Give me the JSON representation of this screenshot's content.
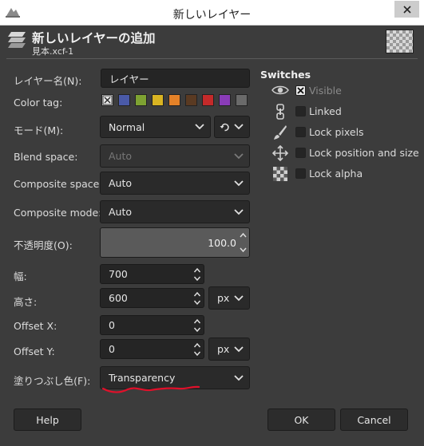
{
  "window": {
    "title": "新しいレイヤー"
  },
  "header": {
    "title": "新しいレイヤーの追加",
    "subtitle": "見本.xcf-1"
  },
  "form": {
    "layer_name": {
      "label": "レイヤー名(N):",
      "value": "レイヤー"
    },
    "color_tag": {
      "label": "Color tag:",
      "swatches": [
        "#4a5aa8",
        "#7ea232",
        "#d9b422",
        "#e58228",
        "#5a3a22",
        "#c42a2a",
        "#8a3cb8",
        "#6a6a6a"
      ]
    },
    "mode": {
      "label": "モード(M):",
      "value": "Normal"
    },
    "blend_space": {
      "label": "Blend space:",
      "value": "Auto"
    },
    "composite_space": {
      "label": "Composite space:",
      "value": "Auto"
    },
    "composite_mode": {
      "label": "Composite mode:",
      "value": "Auto"
    },
    "opacity": {
      "label": "不透明度(O):",
      "value": "100.0"
    },
    "width": {
      "label": "幅:",
      "value": "700"
    },
    "height": {
      "label": "高さ:",
      "value": "600",
      "unit": "px"
    },
    "offset_x": {
      "label": "Offset X:",
      "value": "0"
    },
    "offset_y": {
      "label": "Offset Y:",
      "value": "0",
      "unit": "px"
    },
    "fill": {
      "label": "塗りつぶし色(F):",
      "value": "Transparency"
    }
  },
  "switches": {
    "title": "Switches",
    "items": [
      {
        "label": "Visible",
        "icon": "eye-icon",
        "checked": true
      },
      {
        "label": "Linked",
        "icon": "chain-icon",
        "checked": false
      },
      {
        "label": "Lock pixels",
        "icon": "brush-icon",
        "checked": false
      },
      {
        "label": "Lock position and size",
        "icon": "move-icon",
        "checked": false
      },
      {
        "label": "Lock alpha",
        "icon": "checkerboard-icon",
        "checked": false
      }
    ]
  },
  "buttons": {
    "help": "Help",
    "ok": "OK",
    "cancel": "Cancel"
  },
  "colors": {
    "background": "#3c3c3c",
    "field": "#252525",
    "annotation": "#e0102a"
  }
}
